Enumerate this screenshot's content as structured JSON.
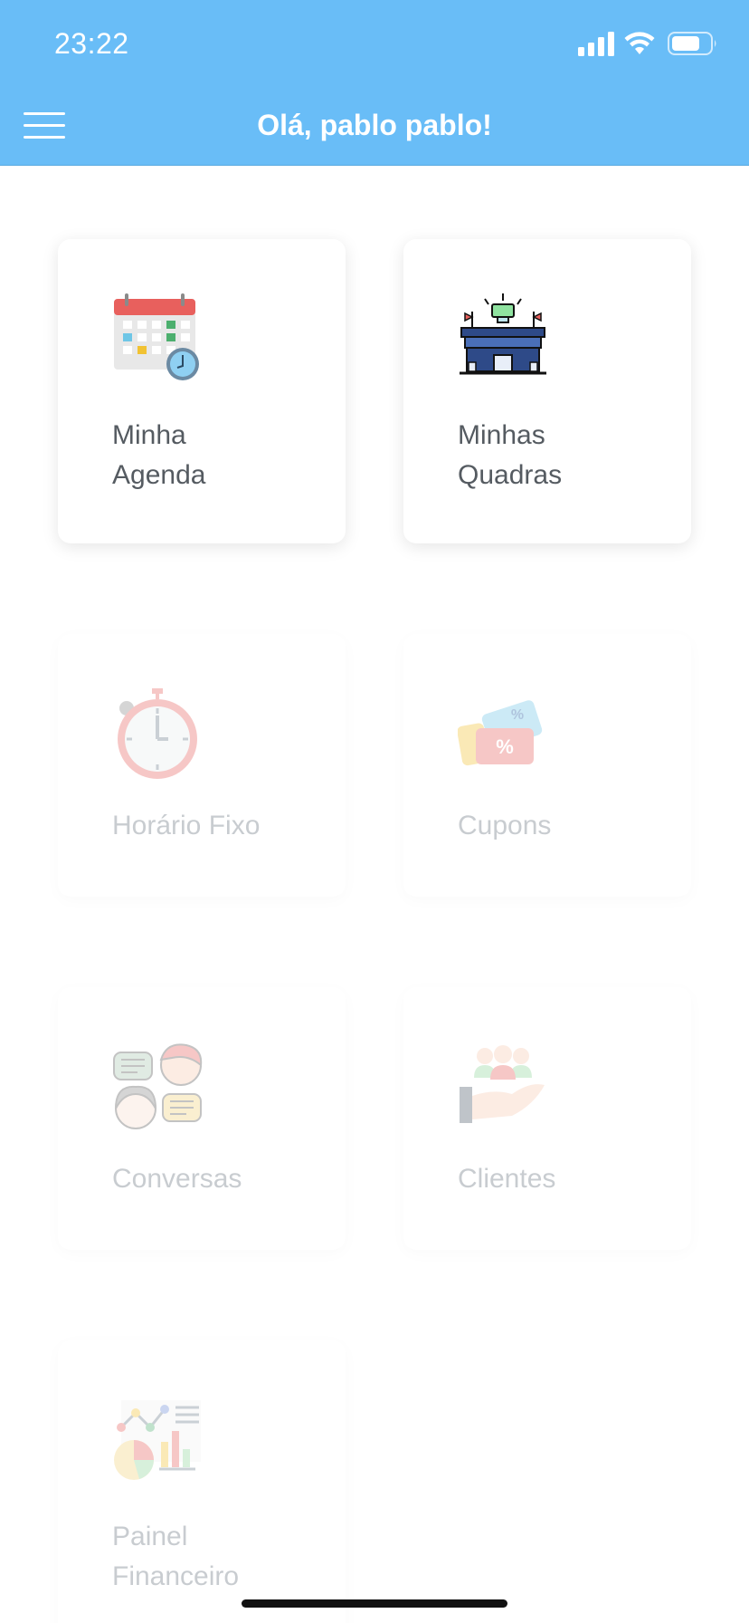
{
  "status_bar": {
    "time": "23:22",
    "icons": [
      "signal-icon",
      "wifi-icon",
      "battery-icon"
    ]
  },
  "header": {
    "title": "Olá, pablo pablo!",
    "menu_icon": "hamburger-menu-icon",
    "background": "#69BDF7"
  },
  "cards": [
    {
      "label": "Minha\nAgenda",
      "icon": "calendar-clock-icon",
      "enabled": true
    },
    {
      "label": "Minhas\nQuadras",
      "icon": "stadium-icon",
      "enabled": true
    },
    {
      "label": "Horário Fixo",
      "icon": "stopwatch-icon",
      "enabled": false
    },
    {
      "label": "Cupons",
      "icon": "coupon-ticket-icon",
      "enabled": false
    },
    {
      "label": "Conversas",
      "icon": "chat-people-icon",
      "enabled": false
    },
    {
      "label": "Clientes",
      "icon": "clients-hand-icon",
      "enabled": false
    },
    {
      "label": "Painel\nFinanceiro",
      "icon": "finance-charts-icon",
      "enabled": false
    }
  ]
}
